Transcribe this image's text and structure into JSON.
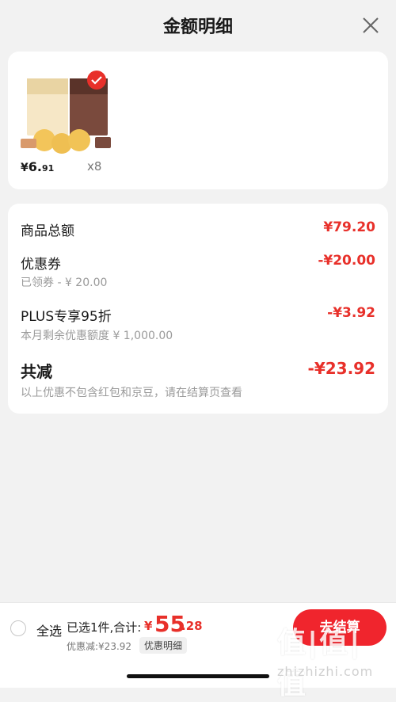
{
  "header": {
    "title": "金额明细"
  },
  "product": {
    "price_symbol": "¥",
    "price_int": "6.",
    "price_dec": "91",
    "quantity": "x8"
  },
  "details": {
    "goods_total_label": "商品总额",
    "goods_total_value": "¥79.20",
    "coupon_label": "优惠券",
    "coupon_value": "-¥20.00",
    "coupon_sub": "已领券 - ¥ 20.00",
    "plus_label": "PLUS专享95折",
    "plus_value": "-¥3.92",
    "plus_sub": "本月剩余优惠额度 ¥ 1,000.00",
    "total_reduce_label": "共减",
    "total_reduce_value": "-¥23.92",
    "note": "以上优惠不包含红包和京豆，请在结算页查看"
  },
  "bottom": {
    "select_all": "全选",
    "summary": "已选1件,合计:",
    "total_symbol": "¥",
    "total_int": "55",
    "total_dec": ".28",
    "discount": "优惠减:¥23.92",
    "detail_tag": "优惠明细",
    "checkout": "去结算"
  },
  "watermark": {
    "text": "值|值|值",
    "url": "zhizhizhi.com"
  },
  "colors": {
    "accent": "#e8302a",
    "button": "#f0252d",
    "background": "#f2f2f2"
  }
}
